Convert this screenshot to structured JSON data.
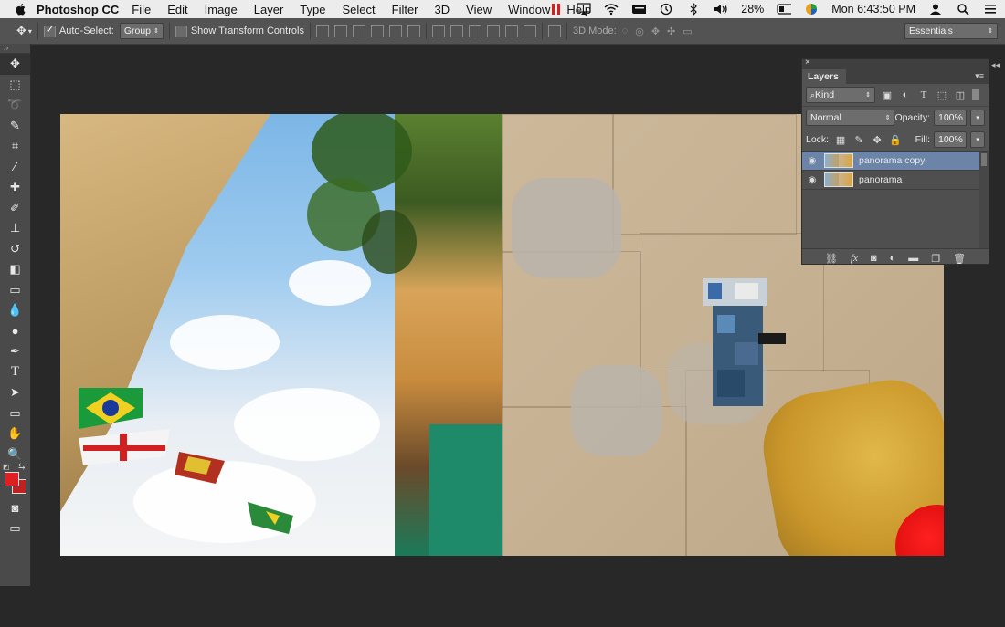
{
  "menubar": {
    "app_name": "Photoshop CC",
    "menus": [
      "File",
      "Edit",
      "Image",
      "Layer",
      "Type",
      "Select",
      "Filter",
      "3D",
      "View",
      "Window",
      "Help"
    ],
    "battery": "28%",
    "clock": "Mon 6:43:50 PM"
  },
  "options": {
    "auto_select_label": "Auto-Select:",
    "auto_select_value": "Group",
    "transform_label": "Show Transform Controls",
    "mode_label": "3D Mode:",
    "workspace": "Essentials"
  },
  "layers_panel": {
    "title": "Layers",
    "filter_kind": "Kind",
    "blend_mode": "Normal",
    "opacity_label": "Opacity:",
    "opacity_value": "100%",
    "lock_label": "Lock:",
    "fill_label": "Fill:",
    "fill_value": "100%",
    "layers": [
      {
        "name": "panorama copy",
        "selected": true
      },
      {
        "name": "panorama",
        "selected": false
      }
    ]
  }
}
